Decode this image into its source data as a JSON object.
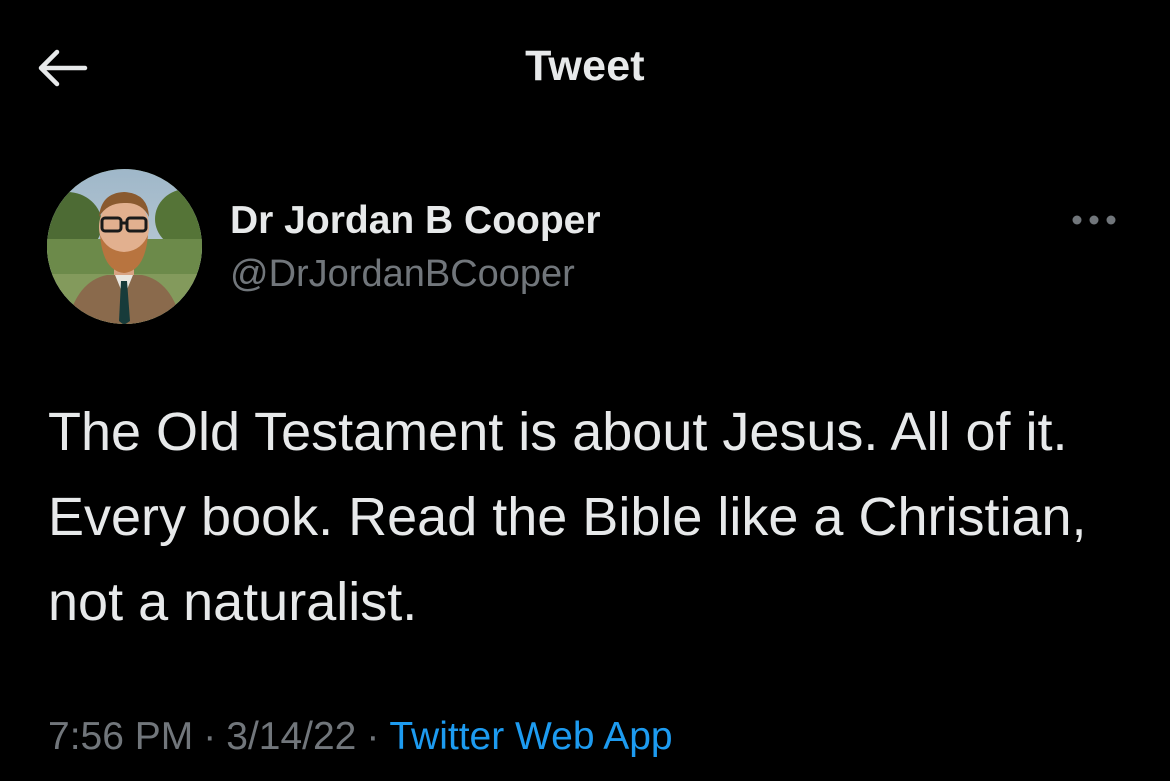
{
  "header": {
    "title": "Tweet",
    "back_icon": "arrow-left-icon"
  },
  "tweet": {
    "author": {
      "name": "Dr Jordan B Cooper",
      "handle": "@DrJordanBCooper"
    },
    "more_icon": "more-horizontal-icon",
    "text": "The Old Testament is about Jesus. All of it. Every book. Read the Bible like a Christian, not a naturalist.",
    "time": "7:56 PM",
    "separator": "·",
    "date": "3/14/22",
    "source": "Twitter Web App"
  },
  "colors": {
    "background": "#000000",
    "primary_text": "#e7e9ea",
    "secondary_text": "#71767b",
    "link": "#1d9bf0"
  }
}
